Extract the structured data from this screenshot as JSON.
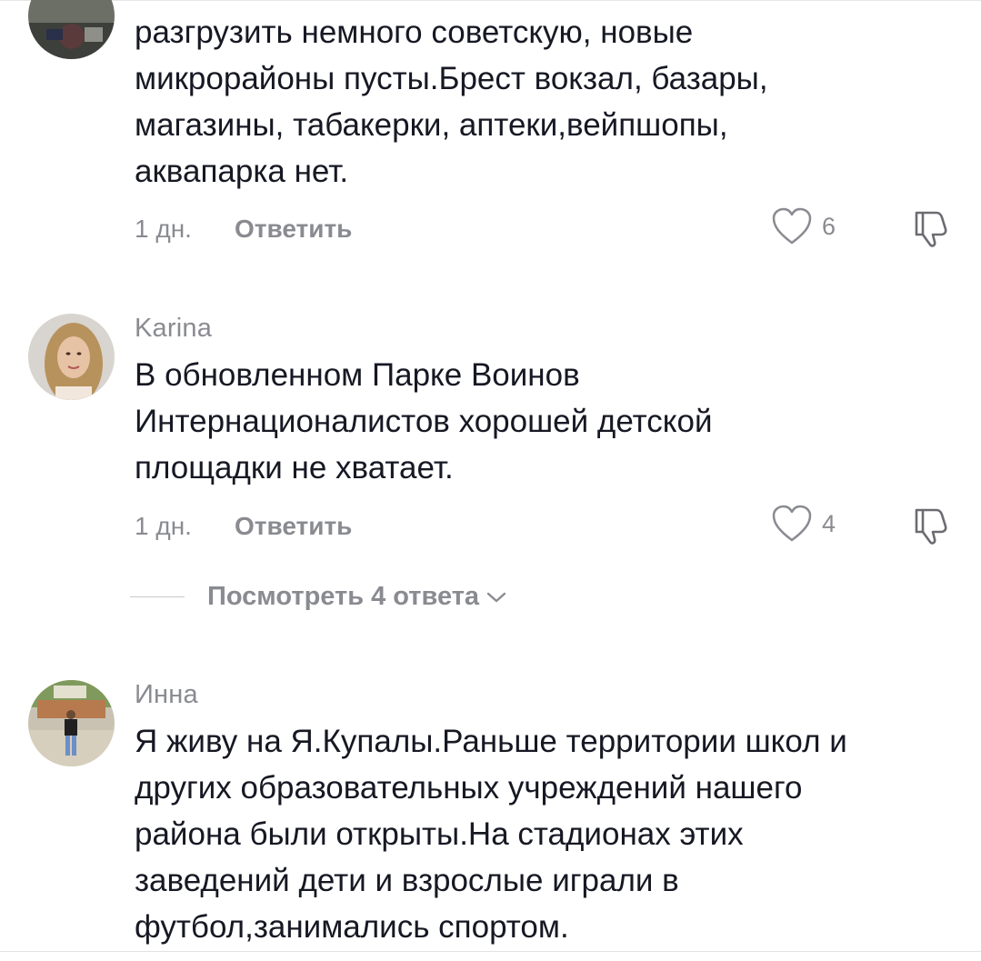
{
  "comments": [
    {
      "author": "",
      "text": "разгрузить немного советскую, новые\nмикрорайоны пусты.Брест вокзал, базары,\nмагазины, табакерки, аптеки,вейпшопы,\nаквапарка нет.",
      "time": "1 дн.",
      "reply_label": "Ответить",
      "likes": "6",
      "avatar_icon": "user-avatar-dark-photo"
    },
    {
      "author": "Karina",
      "text": "В обновленном Парке Воинов\nИнтернационалистов хорошей детской\nплощадки не хватает.",
      "time": "1 дн.",
      "reply_label": "Ответить",
      "likes": "4",
      "avatar_icon": "user-avatar-woman-photo"
    },
    {
      "author": "Инна",
      "text": "Я живу на Я.Купалы.Раньше территории школ и\nдругих образовательных учреждений нашего\nрайона были открыты.На стадионах этих\nзаведений дети и взрослые играли в\nфутбол,занимались спортом.",
      "avatar_icon": "user-avatar-outdoor-photo"
    }
  ],
  "view_replies": {
    "label": "Посмотреть 4 ответа"
  },
  "icons": {
    "like": "heart-outline-icon",
    "dislike": "thumbs-down-icon",
    "expand": "chevron-down-icon"
  },
  "colors": {
    "text": "#161823",
    "secondary": "#8a8b91"
  }
}
